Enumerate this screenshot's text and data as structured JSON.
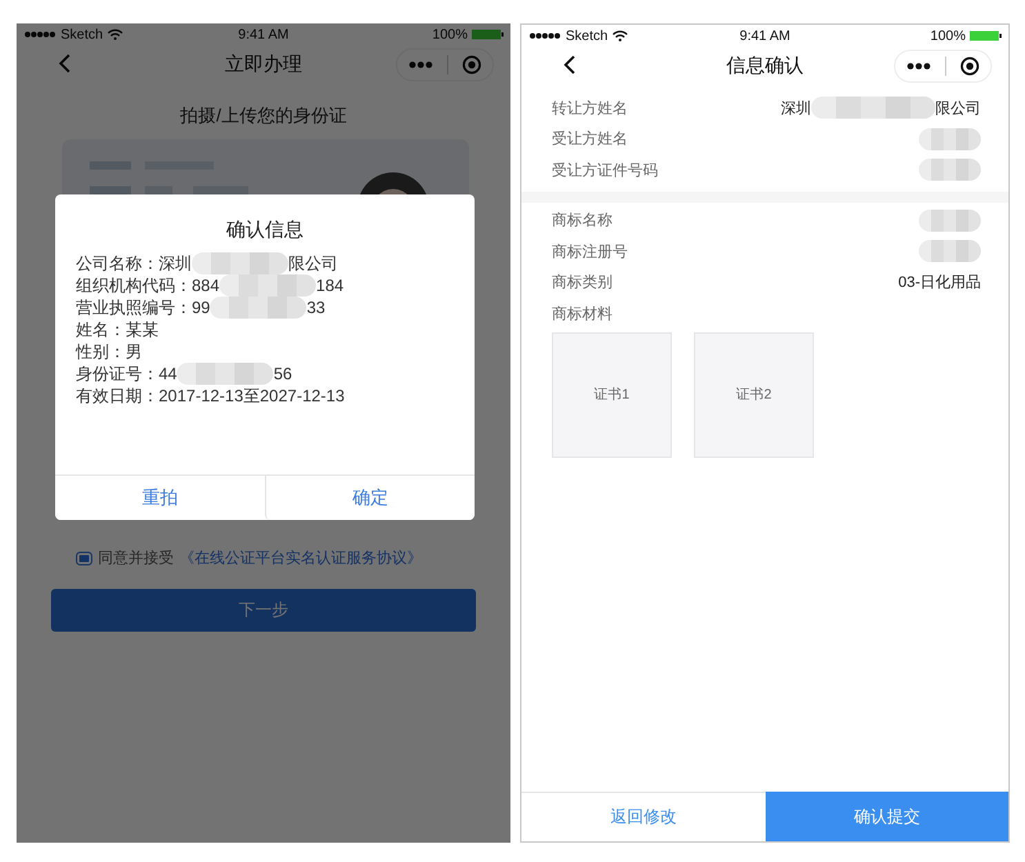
{
  "left_screen": {
    "status_bar": {
      "carrier": "Sketch",
      "time": "9:41 AM",
      "battery": "100%"
    },
    "nav": {
      "title": "立即办理"
    },
    "subtitle": "拍摄/上传您的身份证",
    "agreement": {
      "checked": true,
      "text": "同意并接受",
      "link": "《在线公证平台实名认证服务协议》"
    },
    "next_button": "下一步",
    "dialog": {
      "title": "确认信息",
      "rows": [
        {
          "label": "公司名称：",
          "value": "深圳",
          "value_end": "限公司",
          "redacted": true
        },
        {
          "label": "组织机构代码：",
          "value": "884",
          "value_end": "184",
          "redacted": true
        },
        {
          "label": "营业执照编号：",
          "value": "99",
          "value_end": "33",
          "redacted": true
        },
        {
          "label": "姓名：",
          "value": "某某",
          "redacted": false
        },
        {
          "label": "性别：",
          "value": "男",
          "redacted": false
        },
        {
          "label": "身份证号：",
          "value": "44",
          "value_end": "56",
          "redacted": true
        },
        {
          "label": "有效日期：",
          "value": "2017-12-13至2027-12-13",
          "redacted": false
        }
      ],
      "buttons": [
        "重拍",
        "确定"
      ]
    }
  },
  "right_screen": {
    "status_bar": {
      "carrier": "Sketch",
      "time": "9:41 AM",
      "battery": "100%"
    },
    "nav": {
      "title": "信息确认"
    },
    "sections": [
      {
        "rows": [
          {
            "label": "转让方姓名",
            "value": "深圳",
            "value_end": "限公司",
            "redacted": true
          },
          {
            "label": "受让方姓名",
            "redacted": true
          },
          {
            "label": "受让方证件号码",
            "redacted": true
          }
        ]
      },
      {
        "rows": [
          {
            "label": "商标名称",
            "redacted": true
          },
          {
            "label": "商标注册号",
            "redacted": true
          },
          {
            "label": "商标类别",
            "value": "03-日化用品",
            "redacted": false
          }
        ],
        "materials_label": "商标材料",
        "tiles": [
          "证书1",
          "证书2"
        ]
      }
    ],
    "footer": {
      "back": "返回修改",
      "submit": "确认提交"
    }
  }
}
